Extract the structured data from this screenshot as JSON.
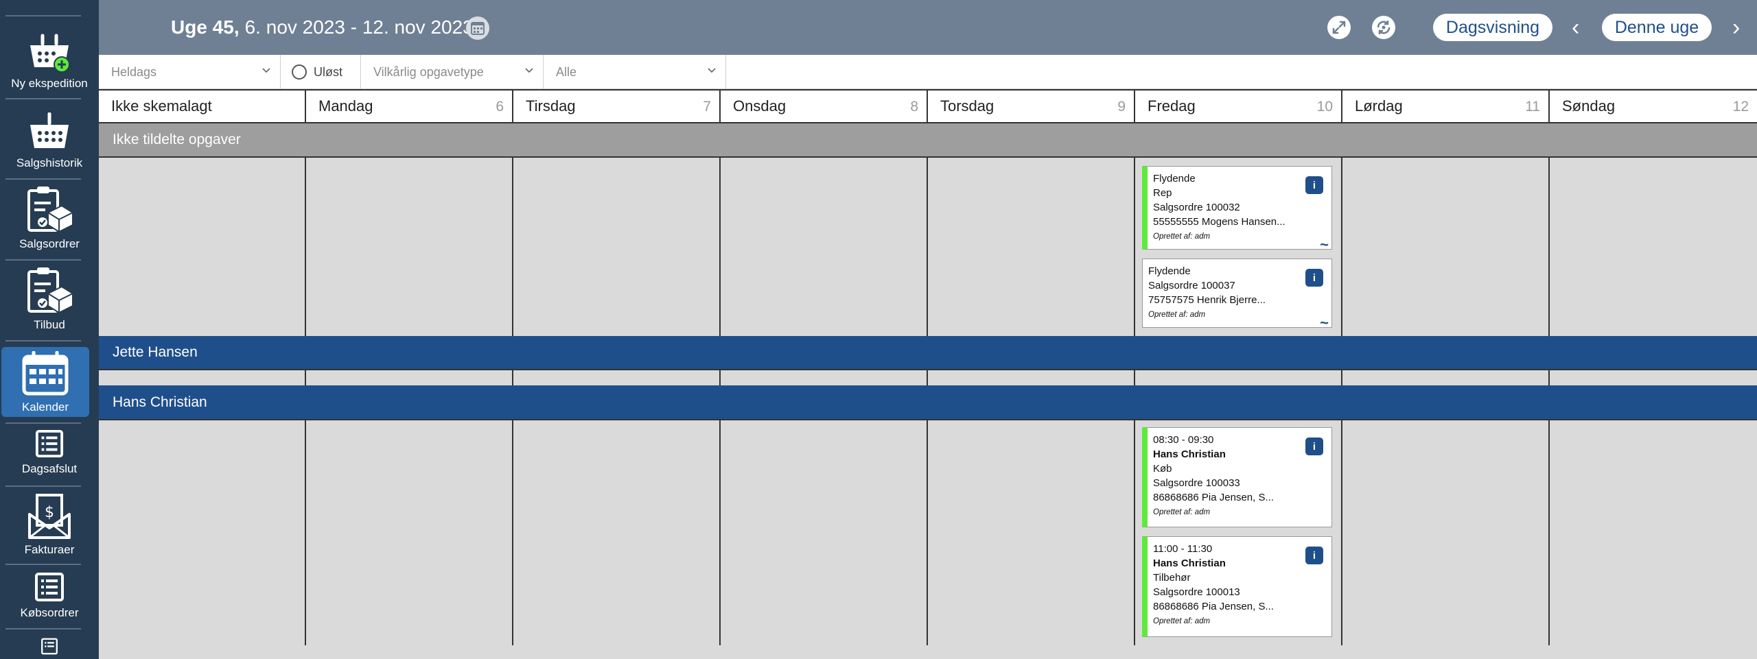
{
  "sidebar": {
    "items": [
      {
        "label": "Ny ekspedition",
        "icon": "basket-add-icon"
      },
      {
        "label": "Salgshistorik",
        "icon": "basket-icon"
      },
      {
        "label": "Salgsordrer",
        "icon": "clipboard-box-icon"
      },
      {
        "label": "Tilbud",
        "icon": "clipboard-box-icon"
      },
      {
        "label": "Kalender",
        "icon": "calendar-icon",
        "active": true
      },
      {
        "label": "Dagsafslut",
        "icon": "list-icon"
      },
      {
        "label": "Fakturaer",
        "icon": "invoice-envelope-icon"
      },
      {
        "label": "Købsordrer",
        "icon": "list-icon"
      }
    ]
  },
  "topbar": {
    "week_label": "Uge 45,",
    "date_range": "6. nov 2023 - 12. nov 2023",
    "day_view_button": "Dagsvisning",
    "this_week_button": "Denne uge",
    "prev": "‹",
    "next": "›"
  },
  "filters": {
    "allday": "Heldags",
    "unresolved": "Uløst",
    "task_type": "Vilkårlig opgavetype",
    "all": "Alle"
  },
  "days": [
    {
      "name": "Ikke skemalagt",
      "num": ""
    },
    {
      "name": "Mandag",
      "num": "6"
    },
    {
      "name": "Tirsdag",
      "num": "7"
    },
    {
      "name": "Onsdag",
      "num": "8"
    },
    {
      "name": "Torsdag",
      "num": "9"
    },
    {
      "name": "Fredag",
      "num": "10"
    },
    {
      "name": "Lørdag",
      "num": "11"
    },
    {
      "name": "Søndag",
      "num": "12"
    }
  ],
  "groups": {
    "unassigned": "Ikke tildelte opgaver",
    "person1": "Jette Hansen",
    "person2": "Hans Christian"
  },
  "cards": [
    {
      "lines": [
        "Flydende",
        "Rep",
        "Salgsordre 100032",
        "55555555 Mogens Hansen..."
      ],
      "created": "Oprettet af: adm",
      "info": "i",
      "tilde": "~"
    },
    {
      "lines": [
        "Flydende",
        "Salgsordre 100037",
        "75757575 Henrik Bjerre..."
      ],
      "created": "Oprettet af: adm",
      "info": "i",
      "tilde": "~"
    },
    {
      "time": "08:30 - 09:30",
      "person": "Hans Christian",
      "lines": [
        "Køb",
        "Salgsordre 100033",
        "86868686 Pia Jensen, S..."
      ],
      "created": "Oprettet af: adm",
      "info": "i"
    },
    {
      "time": "11:00 - 11:30",
      "person": "Hans Christian",
      "lines": [
        "Tilbehør",
        "Salgsordre 100013",
        "86868686 Pia Jensen, S..."
      ],
      "created": "Oprettet af: adm",
      "info": "i"
    }
  ],
  "colors": {
    "sidebar": "#263c52",
    "topbar": "#6f8094",
    "accent": "#1f4f8a",
    "card_stripe": "#5eea3c"
  }
}
